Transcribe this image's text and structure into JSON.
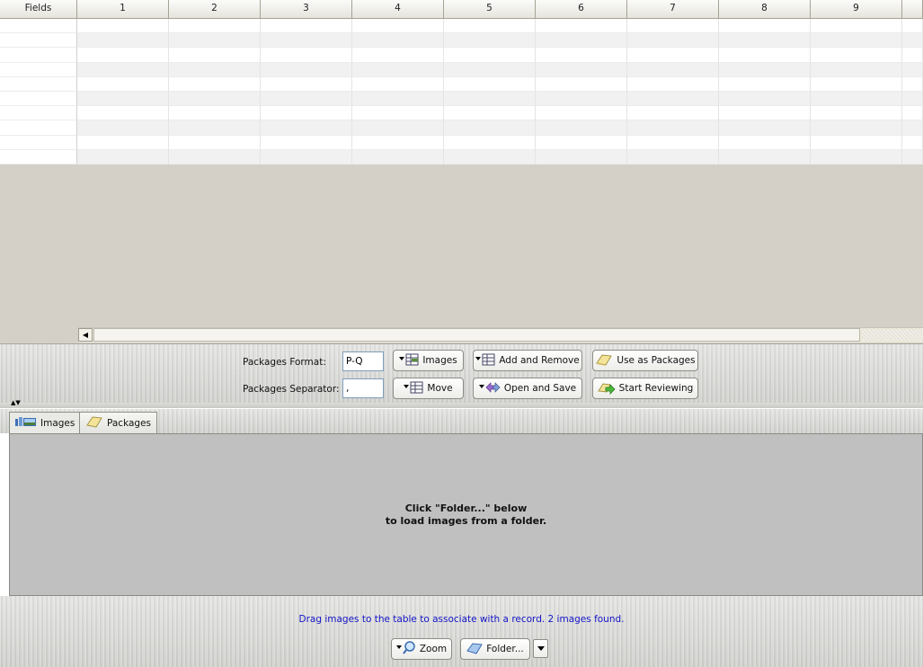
{
  "grid": {
    "columns": [
      "Fields",
      "1",
      "2",
      "3",
      "4",
      "5",
      "6",
      "7",
      "8",
      "9"
    ],
    "row_count": 10
  },
  "packages_toolbar": {
    "format_label": "Packages Format:",
    "format_value": "P-Q",
    "separator_label": "Packages Separator:",
    "separator_value": ",",
    "buttons": {
      "images": "Images",
      "move": "Move",
      "add_remove": "Add and Remove",
      "open_save": "Open and Save",
      "use_as_packages": "Use as Packages",
      "start_reviewing": "Start Reviewing"
    }
  },
  "tabs": [
    {
      "label": "Images",
      "icon": "images-icon",
      "active": true
    },
    {
      "label": "Packages",
      "icon": "packages-icon",
      "active": false
    }
  ],
  "image_pane": {
    "hint_line1": "Click \"Folder...\" below",
    "hint_line2": "to load images from a folder."
  },
  "bottom": {
    "status": "Drag images to the table to associate with a record. 2 images found.",
    "zoom_label": "Zoom",
    "folder_label": "Folder..."
  },
  "colors": {
    "status_text": "#1414c8",
    "image_pane_bg": "#c0c0c0",
    "grid_empty_bg": "#d4d0c8"
  }
}
